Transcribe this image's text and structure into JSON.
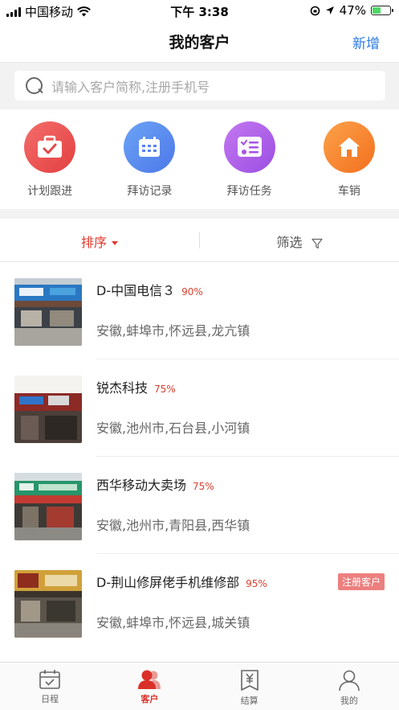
{
  "status_bar": {
    "carrier": "中国移动",
    "time": "下午 3:38",
    "battery": "47%"
  },
  "nav": {
    "title": "我的客户",
    "add_label": "新增"
  },
  "search": {
    "placeholder": "请输入客户简称,注册手机号"
  },
  "quick_actions": [
    {
      "label": "计划跟进",
      "icon": "briefcase-check-icon",
      "color": "#e8474a"
    },
    {
      "label": "拜访记录",
      "icon": "calendar-icon",
      "color": "#5585ec"
    },
    {
      "label": "拜访任务",
      "icon": "task-list-icon",
      "color": "#a556e6"
    },
    {
      "label": "车销",
      "icon": "home-icon",
      "color": "#f57b27"
    }
  ],
  "sortbar": {
    "sort_label": "排序",
    "filter_label": "筛选"
  },
  "customers": [
    {
      "name": "D-中国电信３",
      "percent": "90%",
      "address": "安徽,蚌埠市,怀远县,龙亢镇",
      "badge": ""
    },
    {
      "name": "锐杰科技",
      "percent": "75%",
      "address": "安徽,池州市,石台县,小河镇",
      "badge": ""
    },
    {
      "name": "西华移动大卖场",
      "percent": "75%",
      "address": "安徽,池州市,青阳县,西华镇",
      "badge": ""
    },
    {
      "name": "D-荆山修屏佬手机维修部",
      "percent": "95%",
      "address": "安徽,蚌埠市,怀远县,城关镇",
      "badge": "注册客户"
    }
  ],
  "tabbar": {
    "tabs": [
      {
        "label": "日程",
        "icon": "calendar-check-icon"
      },
      {
        "label": "客户",
        "icon": "customers-icon",
        "active": true
      },
      {
        "label": "结算",
        "icon": "yen-receipt-icon"
      },
      {
        "label": "我的",
        "icon": "person-icon"
      }
    ]
  },
  "colors": {
    "accent_red": "#e03a2e",
    "link_blue": "#2b7be4"
  }
}
